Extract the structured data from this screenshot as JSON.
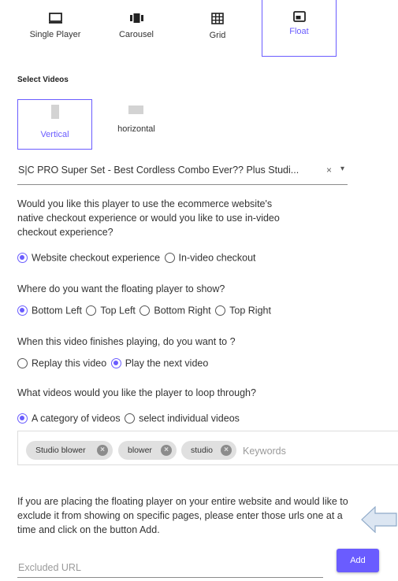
{
  "player_types": [
    {
      "label": "Single Player",
      "icon": "single-player-icon",
      "active": false
    },
    {
      "label": "Carousel",
      "icon": "carousel-icon",
      "active": false
    },
    {
      "label": "Grid",
      "icon": "grid-icon",
      "active": false
    },
    {
      "label": "Float",
      "icon": "float-icon",
      "active": true
    }
  ],
  "select_videos": {
    "title": "Select Videos",
    "orientations": [
      {
        "label": "Vertical",
        "active": true
      },
      {
        "label": "horizontal",
        "active": false
      }
    ]
  },
  "video_select": {
    "value": "S|C PRO Super Set - Best Cordless Combo Ever?? Plus Studi...",
    "clear": "×",
    "caret": "▾"
  },
  "checkout": {
    "question": "Would you like this player to use the ecommerce website's native checkout experience or would you like to use in-video checkout experience?",
    "options": [
      {
        "label": "Website checkout experience",
        "checked": true
      },
      {
        "label": "In-video checkout",
        "checked": false
      }
    ]
  },
  "position": {
    "question": "Where do you want the floating player to show?",
    "options": [
      {
        "label": "Bottom Left",
        "checked": true
      },
      {
        "label": "Top Left",
        "checked": false
      },
      {
        "label": "Bottom Right",
        "checked": false
      },
      {
        "label": "Top Right",
        "checked": false
      }
    ]
  },
  "finish": {
    "question": "When this video finishes playing, do you want to ?",
    "options": [
      {
        "label": "Replay this video",
        "checked": false
      },
      {
        "label": "Play the next video",
        "checked": true
      }
    ]
  },
  "loop": {
    "question": "What videos would you like the player to loop through?",
    "options": [
      {
        "label": "A category of videos",
        "checked": true
      },
      {
        "label": "select individual videos",
        "checked": false
      }
    ]
  },
  "keywords": {
    "chips": [
      "Studio blower",
      "blower",
      "studio"
    ],
    "placeholder": "Keywords"
  },
  "exclude": {
    "note": "If you are placing the floating player on your entire website and would like to exclude it from showing on specific pages, please enter those urls one at a time and click on the button Add.",
    "placeholder": "Excluded URL",
    "add_label": "Add"
  },
  "colors": {
    "accent": "#6A5CFF",
    "arrow_fill": "#DCE6F2",
    "arrow_stroke": "#8EA9C8"
  }
}
